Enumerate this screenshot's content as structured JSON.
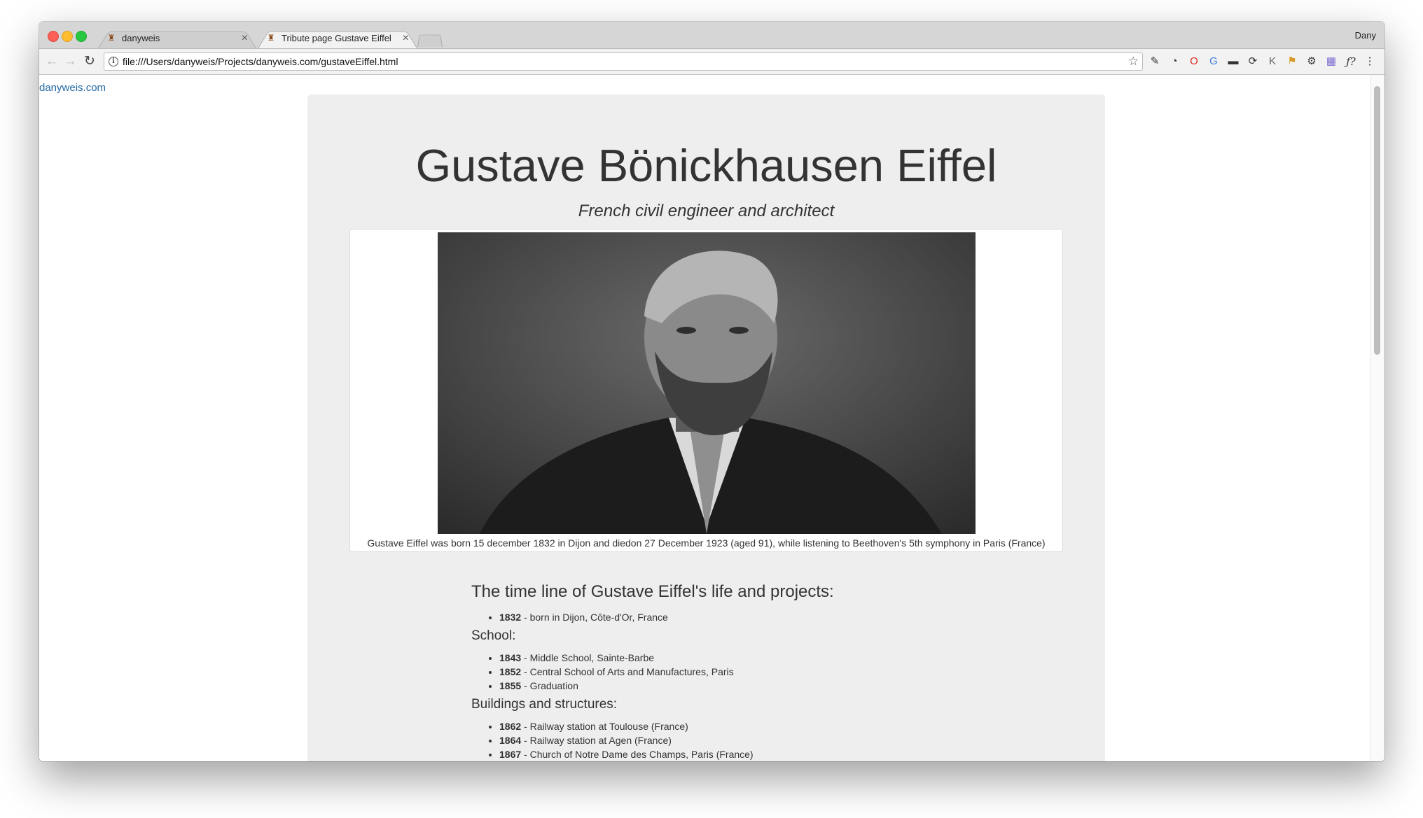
{
  "browser": {
    "tabs": [
      {
        "title": "danyweis",
        "active": false
      },
      {
        "title": "Tribute page Gustave Eiffel",
        "active": true
      }
    ],
    "profile_name": "Dany",
    "address": "file:///Users/danyweis/Projects/danyweis.com/gustaveEiffel.html",
    "extensions": [
      "eyedropper-icon",
      "speedometer-icon",
      "opera-icon",
      "translate-icon",
      "devtools-icon",
      "sync-icon",
      "k-icon",
      "tag-icon",
      "gear-icon",
      "grid-icon",
      "font-icon",
      "menu-icon"
    ]
  },
  "page": {
    "home_link": "danyweis.com",
    "title": "Gustave Bönickhausen Eiffel",
    "subtitle": "French civil engineer and architect",
    "caption": "Gustave Eiffel was born 15 december 1832 in Dijon and diedon 27 December 1923 (aged 91), while listening to Beethoven's 5th symphony in Paris (France)",
    "timeline_heading": "The time line of Gustave Eiffel's life and projects:",
    "birth": [
      {
        "year": "1832",
        "text": " - born in Dijon, Côte-d'Or, France"
      }
    ],
    "school_heading": "School:",
    "school": [
      {
        "year": "1843",
        "text": " - Middle School, Sainte-Barbe"
      },
      {
        "year": "1852",
        "text": " - Central School of Arts and Manufactures, Paris"
      },
      {
        "year": "1855",
        "text": " - Graduation"
      }
    ],
    "buildings_heading": "Buildings and structures:",
    "buildings": [
      {
        "year": "1862",
        "text": " - Railway station at Toulouse (France)"
      },
      {
        "year": "1864",
        "text": " - Railway station at Agen (France)"
      },
      {
        "year": "1867",
        "text": " - Church of Notre Dame des Champs, Paris (France)"
      }
    ]
  },
  "colors": {
    "link": "#2469a5",
    "panel": "#eeeeee",
    "text": "#333333"
  }
}
